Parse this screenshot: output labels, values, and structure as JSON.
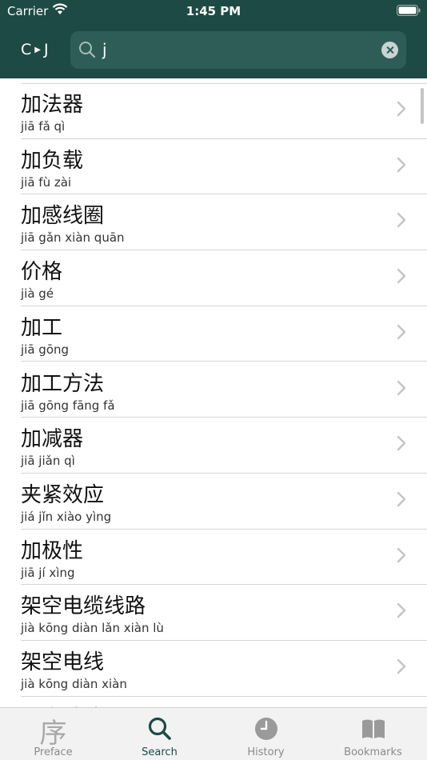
{
  "status_bar": {
    "carrier": "Carrier",
    "time": "1:45 PM"
  },
  "header": {
    "lang_from": "C",
    "lang_to": "J",
    "search_value": "j"
  },
  "rows": [
    {
      "hanzi": "加法器",
      "pinyin": "jiā fǎ qì"
    },
    {
      "hanzi": "加负载",
      "pinyin": "jiā fù zài"
    },
    {
      "hanzi": "加感线圈",
      "pinyin": "jiā gǎn xiàn quān"
    },
    {
      "hanzi": "价格",
      "pinyin": "jià gé"
    },
    {
      "hanzi": "加工",
      "pinyin": "jiā gōng"
    },
    {
      "hanzi": "加工方法",
      "pinyin": "jiā gōng fāng fǎ"
    },
    {
      "hanzi": "加减器",
      "pinyin": "jiā jiǎn qì"
    },
    {
      "hanzi": "夹紧效应",
      "pinyin": "jiá jǐn xiào yìng"
    },
    {
      "hanzi": "加极性",
      "pinyin": "jiā jí xìng"
    },
    {
      "hanzi": "架空电缆线路",
      "pinyin": "jià kōng diàn lǎn xiàn lù"
    },
    {
      "hanzi": "架空电线",
      "pinyin": "jià kōng diàn xiàn"
    },
    {
      "hanzi": "架空地线",
      "pinyin": ""
    }
  ],
  "tabs": [
    {
      "label": "Preface",
      "icon": "preface-glyph-icon",
      "glyph": "序"
    },
    {
      "label": "Search",
      "icon": "search-icon"
    },
    {
      "label": "History",
      "icon": "clock-icon"
    },
    {
      "label": "Bookmarks",
      "icon": "book-icon"
    }
  ],
  "colors": {
    "header_bg": "#1d4a44",
    "search_bg": "#2e5d57",
    "active_tab": "#1d4a44",
    "inactive_tab": "#8a8a8a"
  }
}
